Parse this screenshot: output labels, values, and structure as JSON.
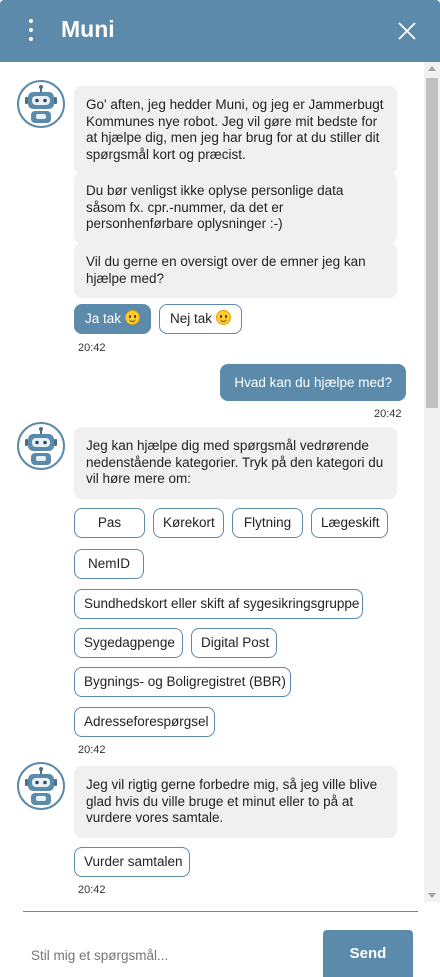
{
  "header": {
    "title": "Muni",
    "menu_icon": "vertical-dots-icon",
    "close_icon": "close-icon"
  },
  "colors": {
    "accent": "#5b8aaa",
    "bot_bubble": "#f0f0f0",
    "background": "#ffffff"
  },
  "messages": {
    "m1": "Go' aften, jeg hedder Muni, og jeg er Jammerbugt Kommunes nye robot. Jeg vil gøre mit bedste for at hjælpe dig, men jeg har brug for at du stiller dit spørgsmål kort og præcist.",
    "m2": "Du bør venligst ikke oplyse personlige data såsom fx. cpr.-nummer, da det er personhenførbare oplysninger :-)",
    "m3": "Vil du gerne en oversigt over de emner jeg kan hjælpe med?",
    "ja": "Ja tak",
    "nej": "Nej tak",
    "t1": "20:42",
    "user": "Hvad kan du hjælpe med?",
    "t2": "20:42",
    "m4": "Jeg kan hjælpe dig med spørgsmål vedrørende nedenstående kategorier. Tryk på den kategori du vil høre mere om:",
    "categories": [
      "Pas",
      "Kørekort",
      "Flytning",
      "Lægeskift",
      "NemID",
      "Sundhedskort eller skift af sygesikringsgruppe",
      "Sygedagpenge",
      "Digital Post",
      "Bygnings- og Boligregistret (BBR)",
      "Adresseforespørgsel"
    ],
    "t3": "20:42",
    "m5": "Jeg vil rigtig gerne forbedre mig, så jeg ville blive glad hvis du ville bruge et minut eller to på at vurdere vores samtale.",
    "rate": "Vurder samtalen",
    "t4": "20:42"
  },
  "composer": {
    "placeholder": "Stil mig et spørgsmål...",
    "send_label": "Send"
  }
}
